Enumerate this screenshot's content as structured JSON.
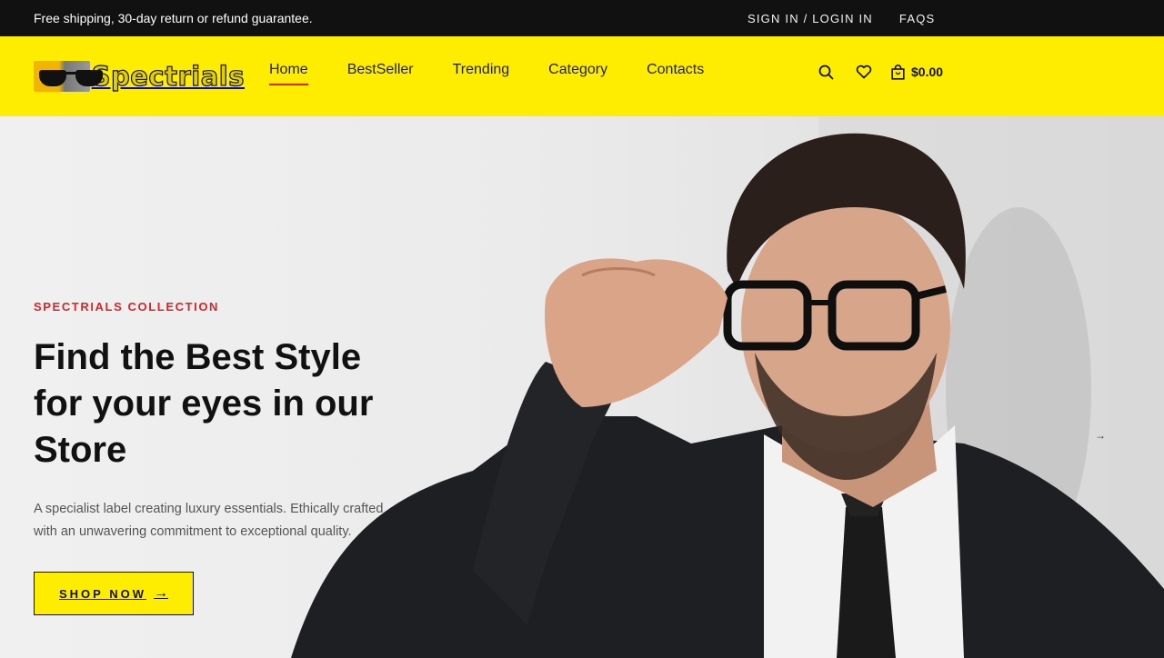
{
  "topbar": {
    "promo": "Free shipping, 30-day return or refund guarantee.",
    "signin": "SIGN IN / LOGIN IN",
    "faqs": "FAQS"
  },
  "header": {
    "logo_text": "Spectrials",
    "nav": [
      "Home",
      "BestSeller",
      "Trending",
      "Category",
      "Contacts"
    ],
    "active_nav": "Home",
    "cart_amount": "$0.00",
    "icons": [
      "search-icon",
      "heart-icon",
      "shopping-bag-icon"
    ]
  },
  "hero": {
    "eyebrow": "SPECTRIALS COLLECTION",
    "headline": "Find the Best Style for your eyes in our Store",
    "description": "A specialist label creating luxury essentials. Ethically crafted with an unwavering commitment to exceptional quality.",
    "cta": "SHOP NOW",
    "cta_arrow": "→",
    "next_arrow": "→"
  },
  "colors": {
    "topbar_bg": "#111111",
    "header_bg": "#ffed00",
    "accent_red": "#d9252b",
    "button_bg": "#ffed00"
  }
}
